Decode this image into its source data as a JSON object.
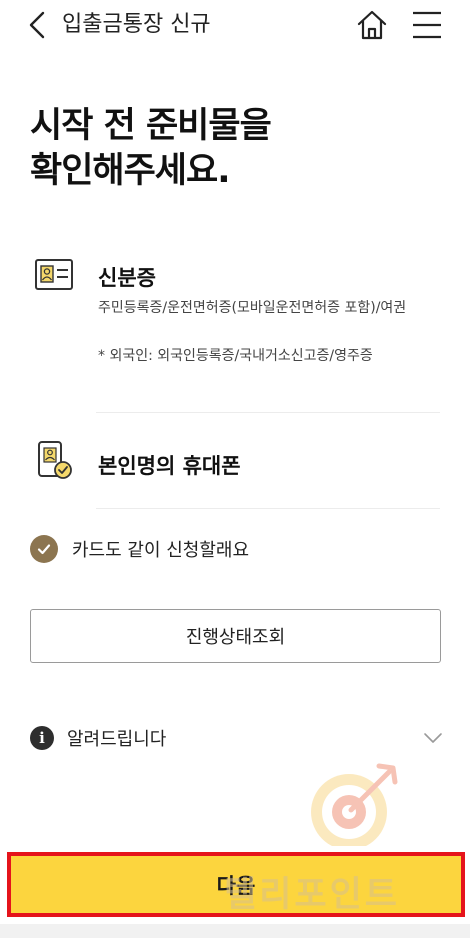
{
  "header": {
    "title": "입출금통장 신규",
    "back_icon": "chevron-left-icon",
    "home_icon": "home-icon",
    "menu_icon": "hamburger-menu-icon"
  },
  "headline": {
    "line1": "시작 전 준비물을",
    "line2": "확인해주세요."
  },
  "requirements": [
    {
      "icon": "id-card-icon",
      "title": "신분증",
      "desc1": "주민등록증/운전면허증(모바일운전면허증 포함)/여권",
      "desc2": "* 외국인: 외국인등록증/국내거소신고증/영주증"
    },
    {
      "icon": "phone-verified-icon",
      "title": "본인명의 휴대폰"
    }
  ],
  "card_option": {
    "label": "카드도 같이 신청할래요",
    "checked": true
  },
  "status_button": "진행상태조회",
  "notice": {
    "label": "알려드립니다",
    "icon": "info-icon",
    "info_glyph": "i"
  },
  "watermark": "텔리포인트",
  "next_button": "다음",
  "colors": {
    "accent_yellow": "#fcd53e",
    "highlight_red": "#e5141b",
    "check_brown": "#8c7550"
  }
}
